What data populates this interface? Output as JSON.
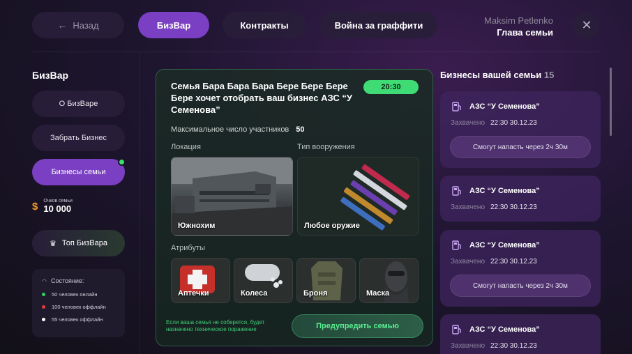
{
  "nav": {
    "back_label": "Назад",
    "tabs": [
      {
        "label": "БизВар",
        "active": true
      },
      {
        "label": "Контракты",
        "active": false
      },
      {
        "label": "Война за граффити",
        "active": false
      }
    ]
  },
  "user": {
    "name": "Maksim Petlenko",
    "role": "Глава семьи"
  },
  "sidebar": {
    "title": "БизВар",
    "items": [
      {
        "label": "О БизВаре",
        "active": false
      },
      {
        "label": "Забрать Бизнес",
        "active": false
      },
      {
        "label": "Бизнесы семьи",
        "active": true
      }
    ],
    "points_label": "Очков семьи",
    "points_value": "10 000",
    "top_label": "Топ БизВара",
    "status": {
      "title": "Состояние:",
      "rows": [
        {
          "text": "50 человек онлайн",
          "color": "#2fd16a"
        },
        {
          "text": "100 человек оффлайн",
          "color": "#e23b3b"
        },
        {
          "text": "55 человек оффлайн",
          "color": "#ffffff"
        }
      ]
    }
  },
  "card": {
    "title": "Семья Бара Бара Бара Бере Бере Бере Бере хочет отобрать ваш бизнес АЗС “У Семенова”",
    "timer": "20:30",
    "max_label": "Максимальное число участников",
    "max_value": "50",
    "location_label": "Локация",
    "location_name": "Южнохим",
    "weapon_label": "Тип вооружения",
    "weapon_name": "Любое оружие",
    "attributes_label": "Атрибуты",
    "attributes": [
      {
        "label": "Аптечки"
      },
      {
        "label": "Колеса"
      },
      {
        "label": "Броня"
      },
      {
        "label": "Маска"
      }
    ],
    "note": "Если ваша семья не соберется, будет назначено техническое поражение",
    "warn_button": "Предупредить семью"
  },
  "right": {
    "title": "Бизнесы вашей семьи",
    "count": "15",
    "businesses": [
      {
        "name": "АЗС “У Семенова”",
        "captured_label": "Захвачено",
        "datetime": "22:30 30.12.23",
        "attack": "Смогут напасть через 2ч 30м"
      },
      {
        "name": "АЗС “У Семенова”",
        "captured_label": "Захвачено",
        "datetime": "22:30 30.12.23",
        "attack": ""
      },
      {
        "name": "АЗС “У Семенова”",
        "captured_label": "Захвачено",
        "datetime": "22:30 30.12.23",
        "attack": "Смогут напасть через 2ч 30м"
      },
      {
        "name": "АЗС “У Семенова”",
        "captured_label": "Захвачено",
        "datetime": "22:30 30.12.23",
        "attack": ""
      }
    ]
  }
}
